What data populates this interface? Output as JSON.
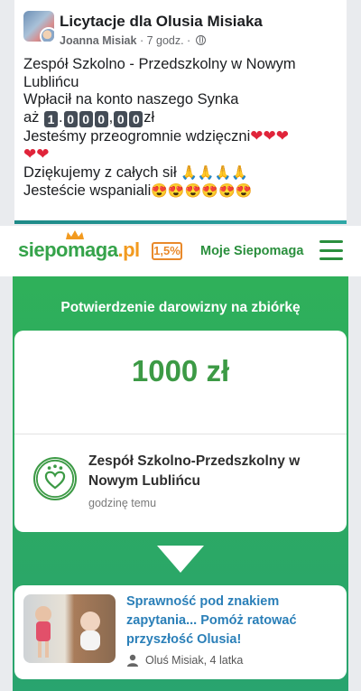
{
  "facebook_post": {
    "group_name": "Licytacje dla Olusia Misiaka",
    "author": "Joanna Misiak",
    "time": "· 7 godz. ·",
    "lines": {
      "l1": "Zespół Szkolno - Przedszkolny w Nowym",
      "l2": "Lublińcu",
      "l3": "Wpłacił na konto naszego Synka",
      "l4_prefix": "aż",
      "digits": [
        "1",
        "0",
        "0",
        "0",
        "0",
        "0"
      ],
      "sep1": ".",
      "sep2": ",",
      "currency": "zł",
      "l5": "Jesteśmy przeogromnie wdzięczni",
      "l6": "Dziękujemy z całych sił",
      "l7": "Jesteście wspaniali"
    },
    "heart_emoji": "❤",
    "pray_emoji": "🙏",
    "smiling_emoji": "😍",
    "accent_color": "#1e8a88"
  },
  "siepomaga": {
    "logo": {
      "part1": "sie",
      "part2": "po",
      "part3": "maga",
      "part4": ".pl"
    },
    "badge": "1,5%",
    "my_link": "Moje Siepomaga",
    "brand_green": "#2a8f3d",
    "brand_orange": "#e9892a"
  },
  "confirmation": {
    "title": "Potwierdzenie darowizny na zbiórkę",
    "amount": "1000 zł",
    "org_name": "Zespół Szkolno-Przedszkolny w Nowym Lublińcu",
    "time_ago": "godzinę temu"
  },
  "fundraiser": {
    "title": "Sprawność pod znakiem zapytania... Pomóż ratować przyszłość Olusia!",
    "author": "Oluś Misiak, 4 latka"
  }
}
